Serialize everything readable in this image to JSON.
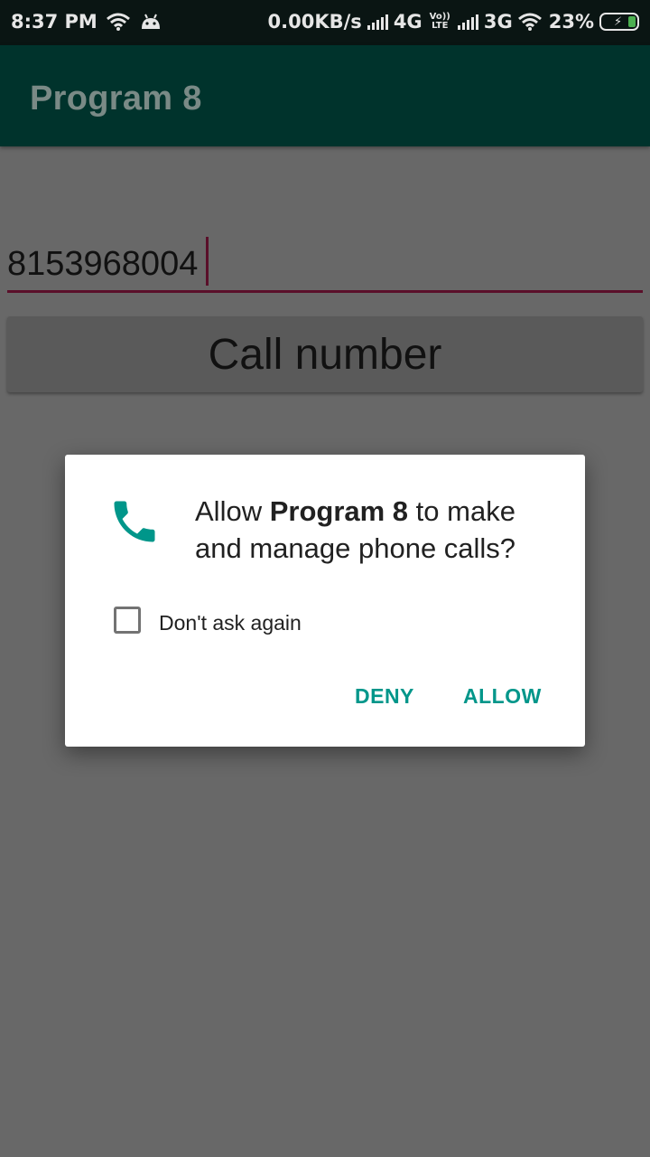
{
  "status_bar": {
    "time": "8:37 PM",
    "net_speed": "0.00KB/s",
    "network_1": "4G",
    "volte_top": "Vo))",
    "volte_bottom": "LTE",
    "network_2": "3G",
    "battery": "23%"
  },
  "app_bar": {
    "title": "Program 8"
  },
  "phone_input": {
    "value": "8153968004"
  },
  "call_button": {
    "label": "Call number"
  },
  "dialog": {
    "msg_prefix": "Allow ",
    "app_name": "Program 8",
    "msg_suffix": " to make and manage phone calls?",
    "checkbox_label": "Don't ask again",
    "checkbox_checked": false,
    "deny_label": "DENY",
    "allow_label": "ALLOW",
    "accent_color": "#00968a",
    "icon": "phone-icon"
  }
}
